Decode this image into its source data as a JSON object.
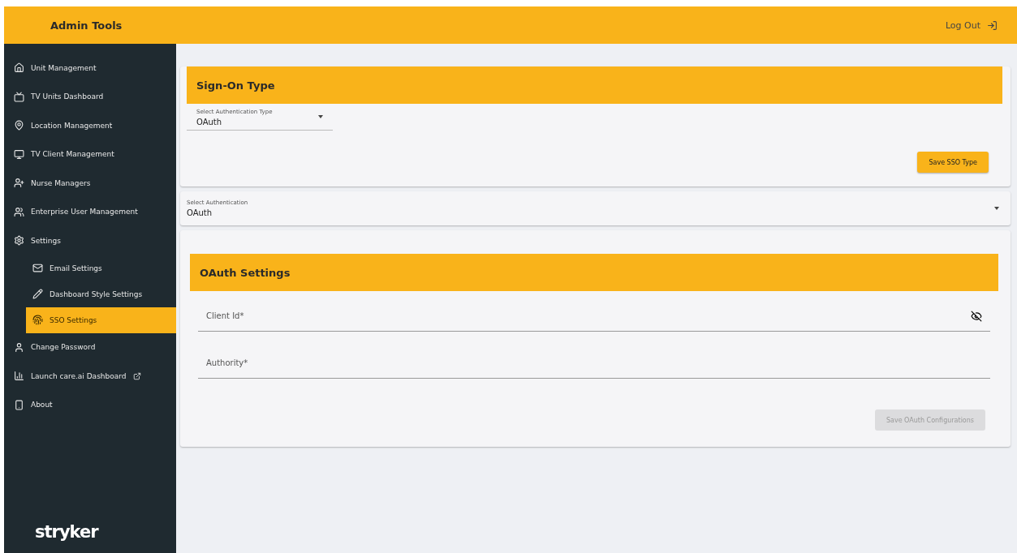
{
  "header": {
    "title": "Admin Tools",
    "logout": "Log Out"
  },
  "sidebar": {
    "items": [
      {
        "label": "Unit Management",
        "selected": false
      },
      {
        "label": "TV Units Dashboard",
        "selected": false
      },
      {
        "label": "Location Management",
        "selected": false
      },
      {
        "label": "TV Client Management",
        "selected": false
      },
      {
        "label": "Nurse Managers",
        "selected": false
      },
      {
        "label": "Enterprise User Management",
        "selected": false
      },
      {
        "label": "Settings",
        "selected": false,
        "expanded": true,
        "children": [
          {
            "label": "Email Settings",
            "selected": false
          },
          {
            "label": "Dashboard Style Settings",
            "selected": false
          },
          {
            "label": "SSO Settings",
            "selected": true
          }
        ]
      },
      {
        "label": "Change Password",
        "selected": false
      },
      {
        "label": "Launch care.ai Dashboard",
        "selected": false,
        "external": true
      },
      {
        "label": "About",
        "selected": false
      }
    ],
    "logo": "stryker"
  },
  "sign_on": {
    "title": "Sign-On Type",
    "select": {
      "label": "Select Authentication Type",
      "value": "OAuth"
    },
    "button": {
      "label": "Save SSO Type",
      "disabled": false
    }
  },
  "auth_select": {
    "label": "Select Authentication",
    "value": "OAuth"
  },
  "oauth": {
    "title": "OAuth Settings",
    "fields": [
      {
        "placeholder": "Client Id*",
        "kind": "secret"
      },
      {
        "placeholder": "Authority*",
        "kind": "text"
      }
    ],
    "button": {
      "label": "Save OAuth Configurations",
      "disabled": true
    }
  }
}
